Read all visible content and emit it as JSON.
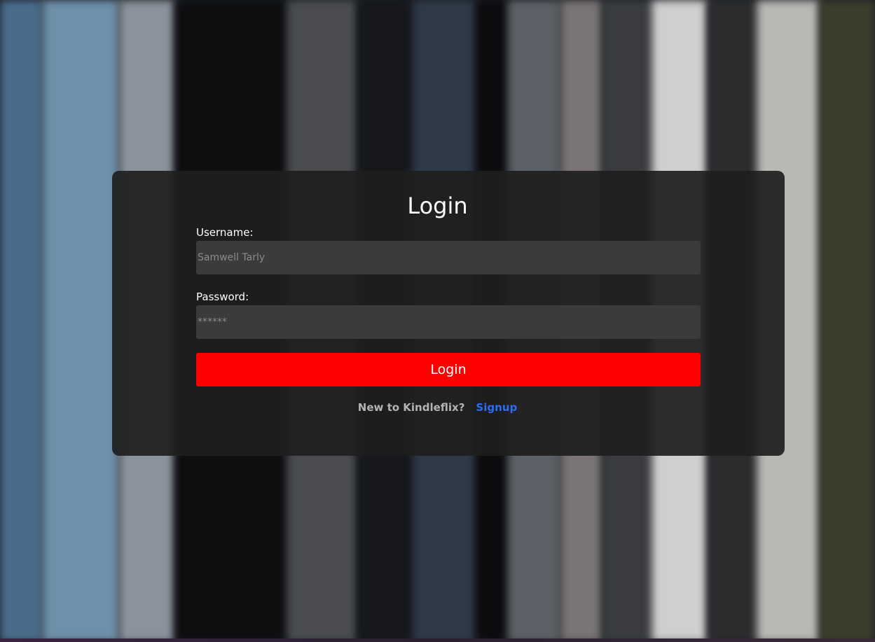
{
  "login_card": {
    "title": "Login",
    "username": {
      "label": "Username:",
      "value": "",
      "placeholder": "Samwell Tarly"
    },
    "password": {
      "label": "Password:",
      "value": "",
      "placeholder": "******"
    },
    "submit_label": "Login",
    "signup_prompt": "New to Kindleflix?",
    "signup_link": "Signup"
  },
  "colors": {
    "accent": "#ff0000",
    "link": "#2e6cf5",
    "card_background": "#1e1e1e",
    "input_background": "#3b3b3b"
  }
}
